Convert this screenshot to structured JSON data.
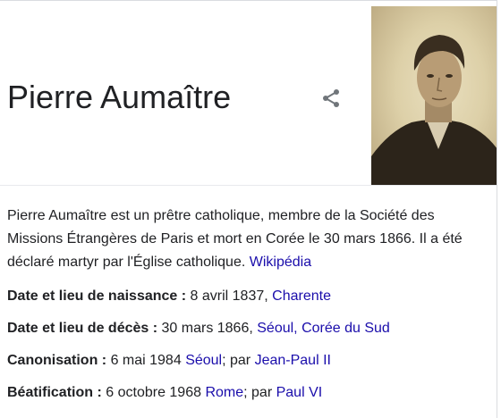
{
  "entity": {
    "title": "Pierre Aumaître"
  },
  "icons": {
    "share": "share-icon",
    "portrait": "portrait-photo"
  },
  "colors": {
    "link": "#1a0dab",
    "text": "#202124",
    "icon": "#70757a"
  },
  "description": {
    "text": "Pierre Aumaître est un prêtre catholique, membre de la Société des Missions Étrangères de Paris et mort en Corée le 30 mars 1866. Il a été déclaré martyr par l'Église catholique.",
    "source_link": "Wikipédia"
  },
  "facts": {
    "birth": {
      "label": "Date et lieu de naissance :",
      "value": "8 avril 1837,",
      "link": "Charente"
    },
    "death": {
      "label": "Date et lieu de décès :",
      "value": "30 mars 1866,",
      "link": "Séoul, Corée du Sud"
    },
    "canonization": {
      "label": "Canonisation :",
      "value": "6 mai 1984",
      "link1": "Séoul",
      "sep": "; par",
      "link2": "Jean-Paul II"
    },
    "beatification": {
      "label": "Béatification :",
      "value": "6 octobre 1968",
      "link1": "Rome",
      "sep": "; par",
      "link2": "Paul VI"
    }
  }
}
